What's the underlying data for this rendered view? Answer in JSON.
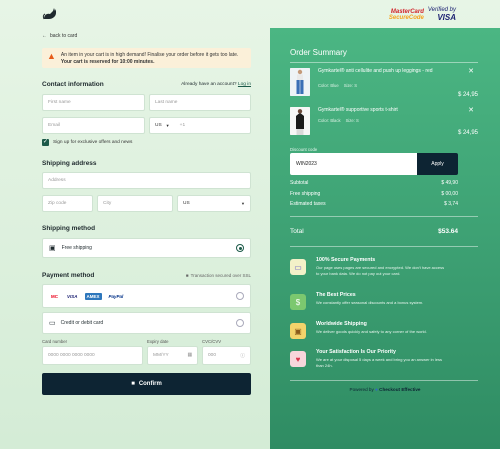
{
  "header": {
    "logo_icon": "cat-logo-icon",
    "mastercard_line1": "MasterCard",
    "mastercard_line2": "SecureCode",
    "visa_line1": "Verified by",
    "visa_line2": "VISA"
  },
  "left": {
    "back_label": "back to card",
    "alert_text": "An item in your cart is in high demand! Finalise your order before it gets too late.",
    "alert_bold": "Your cart is reserved for 10:00 minutes.",
    "contact": {
      "title": "Contact information",
      "account_q": "Already have an account?",
      "login": "Log in",
      "first_name_ph": "First name",
      "last_name_ph": "Last name",
      "email_ph": "Email",
      "country_code": "US",
      "phone_prefix": "+1",
      "signup_label": "Sign up for exclusive offers and news"
    },
    "shipping_address": {
      "title": "Shipping address",
      "address_ph": "Address",
      "zip_ph": "Zip code",
      "city_ph": "City",
      "country": "US"
    },
    "shipping_method": {
      "title": "Shipping method",
      "option": "Free shipping"
    },
    "payment": {
      "title": "Payment method",
      "secure_note": "Transaction secured over SSL",
      "brands": [
        "MC",
        "VISA",
        "AMEX",
        "PayPal"
      ],
      "card_option": "Credit or debit card",
      "card_number_label": "Card number",
      "card_number_ph": "0000  0000  0000  0000",
      "expiry_label": "Expiry date",
      "expiry_ph": "MM/YY",
      "cvc_label": "CVC/CVV",
      "cvc_ph": "000"
    },
    "confirm_label": "Confirm"
  },
  "summary": {
    "title": "Order Summary",
    "items": [
      {
        "name": "Gymkartel® anti cellulite and push up leggings - red",
        "color_label": "Color: Blue",
        "size_label": "Size: S",
        "price": "$ 24,95"
      },
      {
        "name": "Gymkartel® supportive sports t-shirt",
        "color_label": "Color: Black",
        "size_label": "Size: S",
        "price": "$ 24,95"
      }
    ],
    "discount_label": "Discount code",
    "discount_value": "WIN2023",
    "apply_label": "Apply",
    "subtotal_label": "Subtotal",
    "subtotal_value": "$ 49,90",
    "shipping_label": "Free shipping",
    "shipping_value": "$ 00,00",
    "taxes_label": "Estimated taxes",
    "taxes_value": "$ 3,74",
    "total_label": "Total",
    "total_value": "$53.64",
    "features": [
      {
        "title": "100% Secure Payments",
        "text": "Our page uses pages are secured and encrypted. We don't have access to your bank data. We do not pay out your card."
      },
      {
        "title": "The Best Prices",
        "text": "We constantly offer seasonal discounts and a bonus system."
      },
      {
        "title": "Worldwide Shipping",
        "text": "We deliver goods quickly and safely to any corner of the world."
      },
      {
        "title": "Your Satisfaction Is Our Priority",
        "text": "We are at your disposal 5 days a week and bring you an answer in less than 24h."
      }
    ],
    "powered_prefix": "Powered by",
    "powered_brand": "Checkout Effective"
  },
  "colors": {
    "accent": "#1c5a49",
    "panel_green": "#3c9f72",
    "dark": "#0d2433",
    "alert_bg": "#fbf0d9"
  }
}
